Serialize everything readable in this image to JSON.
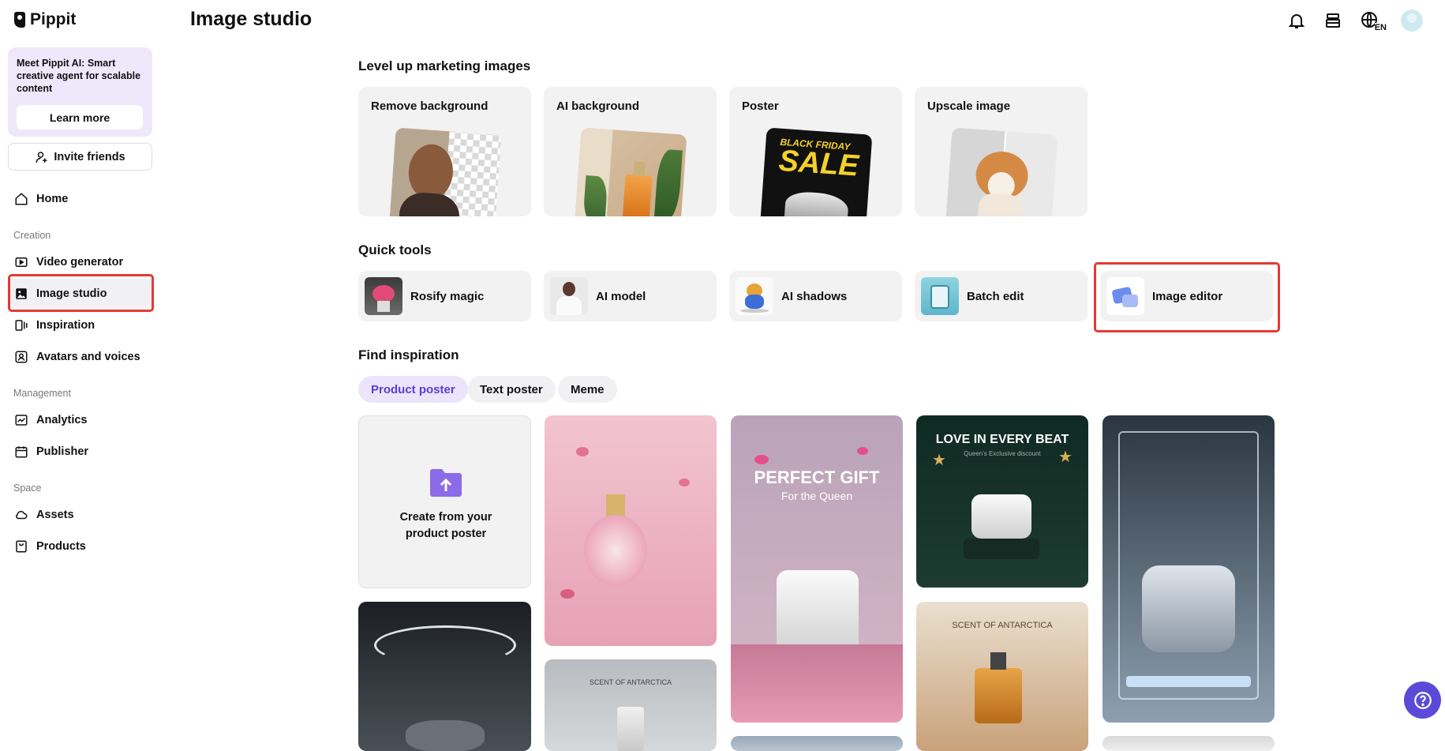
{
  "app": {
    "name": "Pippit",
    "page_title": "Image studio"
  },
  "sidebar": {
    "promo": {
      "text": "Meet Pippit AI: Smart creative agent for scalable content",
      "button": "Learn more"
    },
    "invite_label": "Invite friends",
    "home": "Home",
    "sections": {
      "creation": "Creation",
      "management": "Management",
      "space": "Space"
    },
    "items": {
      "video_generator": "Video generator",
      "image_studio": "Image studio",
      "inspiration": "Inspiration",
      "avatars_voices": "Avatars and voices",
      "analytics": "Analytics",
      "publisher": "Publisher",
      "assets": "Assets",
      "products": "Products"
    }
  },
  "header": {
    "icons": [
      "bell-icon",
      "stack-icon",
      "globe-language-icon",
      "user-avatar"
    ],
    "language": "EN"
  },
  "main": {
    "level_up": {
      "title": "Level up marketing images",
      "cards": [
        "Remove background",
        "AI background",
        "Poster",
        "Upscale image"
      ]
    },
    "quick_tools": {
      "title": "Quick tools",
      "tools": [
        "Rosify magic",
        "AI model",
        "AI shadows",
        "Batch edit",
        "Image editor"
      ]
    },
    "find_inspiration": {
      "title": "Find inspiration",
      "tabs": [
        "Product poster",
        "Text poster",
        "Meme"
      ],
      "active_tab": "Product poster",
      "create_card": "Create from your product poster",
      "poster_texts": {
        "sale_top": "BLACK FRIDAY",
        "sale_main": "SALE",
        "gift_title": "PERFECT GIFT",
        "gift_sub": "For the Queen",
        "love_title": "LOVE IN EVERY BEAT",
        "love_sub": "Queen's Exclusive discount",
        "scent_a": "SCENT OF ANTARCTICA",
        "scent_b": "SCENT OF ANTARCTICA"
      }
    }
  },
  "colors": {
    "accent": "#5b4ad8",
    "highlight": "#e53935",
    "active_chip_bg": "#ebe4fb",
    "active_chip_text": "#5b3fd1"
  }
}
